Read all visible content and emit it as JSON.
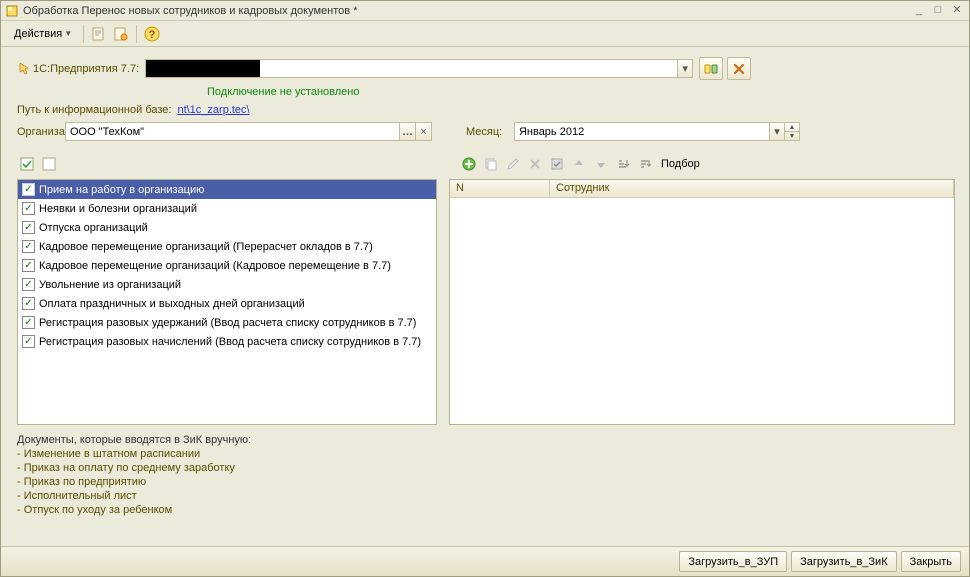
{
  "window": {
    "title": "Обработка   Перенос новых сотрудников и кадровых документов *"
  },
  "toolbar": {
    "actions": "Действия"
  },
  "db_row": {
    "label": "1С:Предприятия 7.7:",
    "value": ""
  },
  "status": "Подключение не установлено",
  "path_row": {
    "label": "Путь к информационной базе:",
    "link": "nt\\1c_zarp.tec\\"
  },
  "org_row": {
    "label": "Организа",
    "value": "ООО \"ТехКом\""
  },
  "month_row": {
    "label": "Месяц:",
    "value": "Январь 2012"
  },
  "selection_label": "Подбор",
  "checklist": {
    "items": [
      {
        "label": "Прием на работу в организацию",
        "checked": true,
        "selected": true
      },
      {
        "label": "Неявки и болезни организаций",
        "checked": true
      },
      {
        "label": "Отпуска организаций",
        "checked": true
      },
      {
        "label": "Кадровое перемещение организаций (Перерасчет окладов в 7.7)",
        "checked": true
      },
      {
        "label": "Кадровое перемещение организаций (Кадровое перемещение в 7.7)",
        "checked": true
      },
      {
        "label": "Увольнение из организаций",
        "checked": true
      },
      {
        "label": "Оплата праздничных и выходных дней организаций",
        "checked": true
      },
      {
        "label": "Регистрация разовых удержаний (Ввод расчета списку сотрудников в 7.7)",
        "checked": true
      },
      {
        "label": "Регистрация разовых начислений (Ввод расчета списку сотрудников в 7.7)",
        "checked": true
      }
    ]
  },
  "grid": {
    "col1": "N",
    "col2": "Сотрудник"
  },
  "notes": {
    "title": "Документы, которые вводятся в ЗиК вручную:",
    "lines": [
      "- Изменение в штатном расписании",
      "- Приказ на оплату по среднему заработку",
      "- Приказ по предприятию",
      "- Исполнительный лист",
      "- Отпуск по уходу за ребенком"
    ]
  },
  "buttons": {
    "load_zup": "Загрузить_в_ЗУП",
    "load_zik": "Загрузить_в_ЗиК",
    "close": "Закрыть"
  }
}
